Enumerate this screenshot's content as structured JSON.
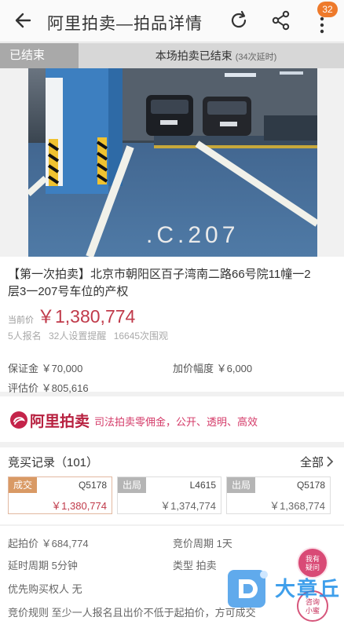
{
  "header": {
    "title": "阿里拍卖—拍品详情",
    "badge_count": "32",
    "icons": [
      "back-arrow-icon",
      "refresh-icon",
      "share-icon",
      "more-vertical-icon"
    ]
  },
  "status": {
    "tag": "已结束",
    "message": "本场拍卖已结束",
    "sub": "(34次延时)"
  },
  "photo": {
    "parking_label": ".C.207"
  },
  "item": {
    "title": "【第一次拍卖】北京市朝阳区百子湾南二路66号院11幢一2层3一207号车位的产权",
    "price_label": "当前价",
    "current_price": "￥1,380,774",
    "stats": "5人报名 32人设置提醒 16645次围观"
  },
  "fields": {
    "deposit": "保证金 ￥70,000",
    "increment": "加价幅度 ￥6,000",
    "appraisal": "评估价 ￥805,616"
  },
  "brand": {
    "name": "阿里拍卖",
    "slogan": "司法拍卖零佣金，公开、透明、高效"
  },
  "records": {
    "title": "竞买记录（101）",
    "all_label": "全部",
    "bids": [
      {
        "status": "成交",
        "bidder": "Q5178",
        "amount": "￥1,380,774"
      },
      {
        "status": "出局",
        "bidder": "L4615",
        "amount": "￥1,374,774"
      },
      {
        "status": "出局",
        "bidder": "Q5178",
        "amount": "￥1,368,774"
      }
    ]
  },
  "rules": {
    "start_price": "起拍价 ￥684,774",
    "cycle": "竞价周期 1天",
    "delay": "延时周期 5分钟",
    "type": "类型 拍卖",
    "priority": "优先购买权人 无",
    "rule": "竞价规则 至少一人报名且出价不低于起拍价，方可成交"
  },
  "float_buttons": {
    "faq": "我有\n疑问",
    "consult": "咨询\n小蜜"
  },
  "watermark": {
    "text": "大章丘"
  },
  "colors": {
    "price": "#c03a4a",
    "brand": "#b7203f",
    "badge": "#ee7a2b"
  }
}
